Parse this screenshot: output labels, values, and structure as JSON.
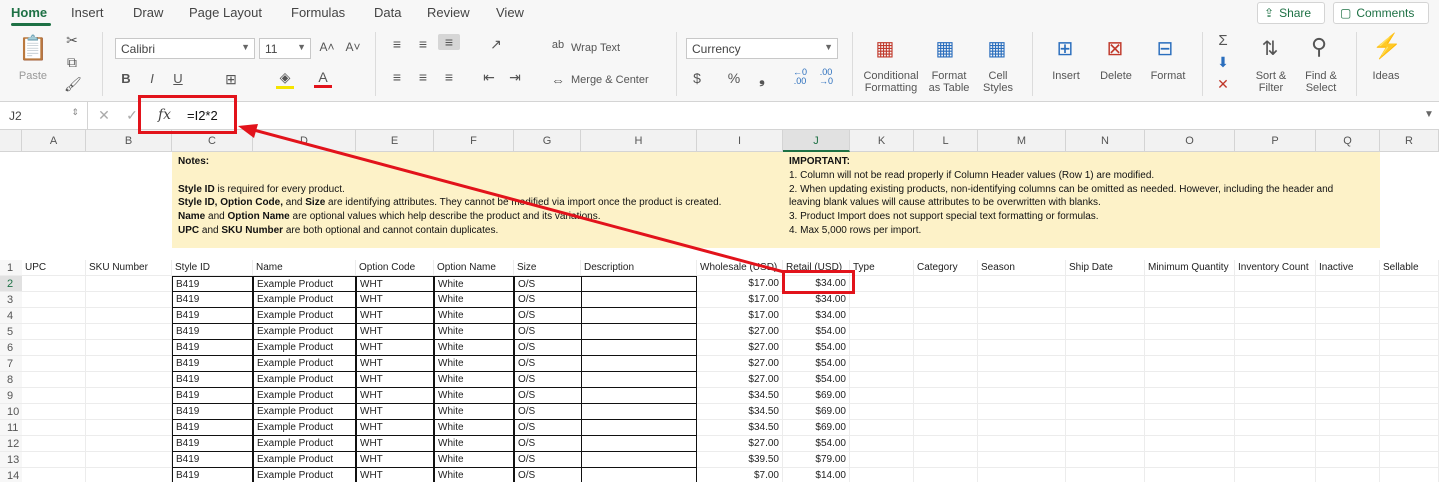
{
  "ribbon_tabs": [
    "Home",
    "Insert",
    "Draw",
    "Page Layout",
    "Formulas",
    "Data",
    "Review",
    "View"
  ],
  "active_tab": "Home",
  "share_label": "Share",
  "comments_label": "Comments",
  "ribbon": {
    "paste": "Paste",
    "font_name": "Calibri",
    "font_size": "11",
    "wrap_text": "Wrap Text",
    "merge_center": "Merge & Center",
    "number_format": "Currency",
    "conditional_formatting": [
      "Conditional",
      "Formatting"
    ],
    "format_as_table": [
      "Format",
      "as Table"
    ],
    "cell_styles": [
      "Cell",
      "Styles"
    ],
    "insert": "Insert",
    "delete": "Delete",
    "format": "Format",
    "sort_filter": [
      "Sort &",
      "Filter"
    ],
    "find_select": [
      "Find &",
      "Select"
    ],
    "ideas": "Ideas",
    "dec_inc_1": "←0",
    "dec_inc_2": ".00",
    "dec_dec_1": ".00",
    "dec_dec_2": "→0"
  },
  "formula_bar": {
    "name_box": "J2",
    "fx": "fx",
    "formula": "=I2*2"
  },
  "columns": [
    "A",
    "B",
    "C",
    "D",
    "E",
    "F",
    "G",
    "H",
    "I",
    "J",
    "K",
    "L",
    "M",
    "N",
    "O",
    "P",
    "Q",
    "R"
  ],
  "selected_column": "J",
  "notes": {
    "left_title": "Notes:",
    "left_lines": [
      [
        {
          "b": "Style ID"
        },
        {
          "t": " is required for every product."
        }
      ],
      [
        {
          "b": "Style ID, Option Code,"
        },
        {
          "t": " and "
        },
        {
          "b": "Size"
        },
        {
          "t": " are identifying attributes. They cannot be modified via import once the product is created."
        }
      ],
      [
        {
          "b": "Name"
        },
        {
          "t": " and "
        },
        {
          "b": "Option Name"
        },
        {
          "t": " are optional values which help describe the product and its variations."
        }
      ],
      [
        {
          "b": "UPC"
        },
        {
          "t": " and "
        },
        {
          "b": "SKU Number"
        },
        {
          "t": " are both optional and cannot contain duplicates."
        }
      ]
    ],
    "right_title": "IMPORTANT:",
    "right_lines": [
      "1. Column will not be read properly if Column Header values (Row 1) are modified.",
      "2. When updating existing products, non-identifying columns can be omitted as needed. However, including the header and",
      "leaving blank values will cause attributes to be overwritten with blanks.",
      "3. Product Import does not support special text formatting or formulas.",
      "4. Max 5,000 rows per import."
    ]
  },
  "header_row": [
    "UPC",
    "SKU Number",
    "Style ID",
    "Name",
    "Option Code",
    "Option Name",
    "Size",
    "Description",
    "Wholesale (USD)",
    "Retail (USD)",
    "Type",
    "Category",
    "Season",
    "Ship Date",
    "Minimum Quantity",
    "Inventory Count",
    "Inactive",
    "Sellable"
  ],
  "row_numbers": [
    "1",
    "2",
    "3",
    "4",
    "5",
    "6",
    "7",
    "8",
    "9",
    "10",
    "11",
    "12",
    "13",
    "14"
  ],
  "rows": [
    [
      "B419",
      "Example Product",
      "WHT",
      "White",
      "O/S",
      "$17.00",
      "$34.00"
    ],
    [
      "B419",
      "Example Product",
      "WHT",
      "White",
      "O/S",
      "$17.00",
      "$34.00"
    ],
    [
      "B419",
      "Example Product",
      "WHT",
      "White",
      "O/S",
      "$17.00",
      "$34.00"
    ],
    [
      "B419",
      "Example Product",
      "WHT",
      "White",
      "O/S",
      "$27.00",
      "$54.00"
    ],
    [
      "B419",
      "Example Product",
      "WHT",
      "White",
      "O/S",
      "$27.00",
      "$54.00"
    ],
    [
      "B419",
      "Example Product",
      "WHT",
      "White",
      "O/S",
      "$27.00",
      "$54.00"
    ],
    [
      "B419",
      "Example Product",
      "WHT",
      "White",
      "O/S",
      "$27.00",
      "$54.00"
    ],
    [
      "B419",
      "Example Product",
      "WHT",
      "White",
      "O/S",
      "$34.50",
      "$69.00"
    ],
    [
      "B419",
      "Example Product",
      "WHT",
      "White",
      "O/S",
      "$34.50",
      "$69.00"
    ],
    [
      "B419",
      "Example Product",
      "WHT",
      "White",
      "O/S",
      "$34.50",
      "$69.00"
    ],
    [
      "B419",
      "Example Product",
      "WHT",
      "White",
      "O/S",
      "$27.00",
      "$54.00"
    ],
    [
      "B419",
      "Example Product",
      "WHT",
      "White",
      "O/S",
      "$39.50",
      "$79.00"
    ],
    [
      "B419",
      "Example Product",
      "WHT",
      "White",
      "O/S",
      "$7.00",
      "$14.00"
    ]
  ],
  "colors": {
    "accent": "#1e7145",
    "annotation": "#e2131b",
    "notes_bg": "#fdf2c8"
  }
}
